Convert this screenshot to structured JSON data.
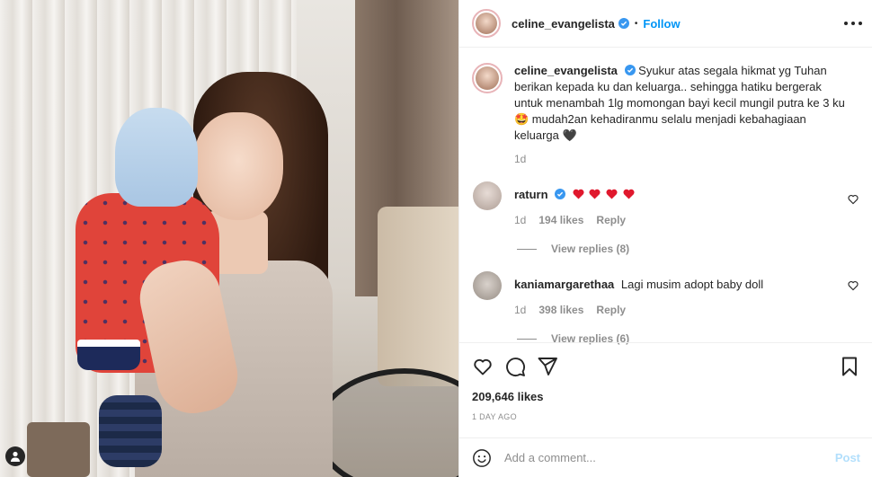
{
  "post": {
    "username": "celine_evangelista",
    "follow_label": "Follow",
    "dot": "•",
    "more_icon": "more-horizontal-icon",
    "caption": "Syukur atas segala hikmat yg Tuhan berikan kepada ku dan keluarga.. sehingga hatiku bergerak untuk menambah 1lg momongan bayi kecil mungil putra ke 3 ku 🤩 mudah2an kehadiranmu selalu menjadi kebahagiaan keluarga 🖤",
    "caption_time": "1d",
    "likes": "209,646 likes",
    "date": "1 DAY AGO",
    "accent_color": "#0095f6"
  },
  "comments": [
    {
      "username": "raturn",
      "verified": true,
      "hearts_count": 4,
      "time": "1d",
      "likes": "194 likes",
      "reply_label": "Reply",
      "view_replies": "View replies (8)"
    },
    {
      "username": "kaniamargarethaa",
      "verified": false,
      "text": "Lagi musim adopt baby doll",
      "time": "1d",
      "likes": "398 likes",
      "reply_label": "Reply",
      "view_replies": "View replies (6)"
    }
  ],
  "add_comment": {
    "placeholder": "Add a comment...",
    "post_label": "Post"
  }
}
